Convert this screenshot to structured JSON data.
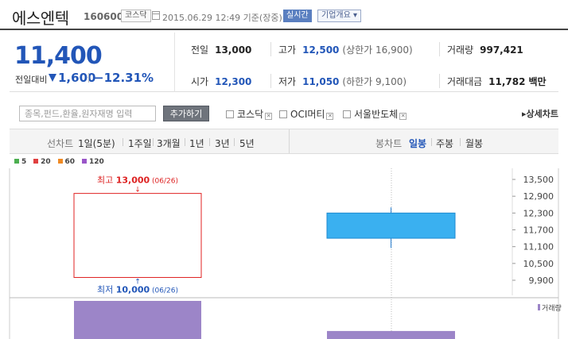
{
  "header": {
    "company_name": "에스엔텍",
    "stock_code": "160600",
    "market_badge": "코스닥",
    "datetime_text": "2015.06.29 12:49 기준(장중)",
    "realtime_badge": "실시간",
    "company_info_button": "기업개요 ▾"
  },
  "price": {
    "current": "11,400",
    "change_label": "전일대비",
    "change_value": "1,600",
    "change_percent": "−12.31%",
    "direction": "down"
  },
  "stats": {
    "prev_close_label": "전일",
    "prev_close": "13,000",
    "open_label": "시가",
    "open": "12,300",
    "high_label": "고가",
    "high": "12,500",
    "upper_limit": "(상한가 16,900)",
    "low_label": "저가",
    "low": "11,050",
    "lower_limit": "(하한가 9,100)",
    "volume_label": "거래량",
    "volume": "997,421",
    "amount_label": "거래대금",
    "amount": "11,782",
    "amount_unit": "백만"
  },
  "compare": {
    "search_placeholder": "종목,펀드,환율,원자재명 입력",
    "add_button": "추가하기",
    "options": [
      {
        "label": "코스닥"
      },
      {
        "label": "OCI머티"
      },
      {
        "label": "서울반도체"
      }
    ],
    "detail_chart_link": "▸상세차트"
  },
  "toolbar": {
    "line_chart_label": "선차트",
    "line_periods": [
      "1일(5분)",
      "1주일",
      "3개월",
      "1년",
      "3년",
      "5년"
    ],
    "candle_chart_label": "봉차트",
    "candle_periods": [
      "일봉",
      "주봉",
      "월봉"
    ],
    "active_candle": "일봉"
  },
  "legend": [
    {
      "label": "5",
      "color": "#4caf50"
    },
    {
      "label": "20",
      "color": "#e04040"
    },
    {
      "label": "60",
      "color": "#f08a24"
    },
    {
      "label": "120",
      "color": "#9a55c8"
    }
  ],
  "chart_data": {
    "type": "candlestick",
    "y_ticks": [
      "13,500",
      "12,900",
      "12,300",
      "11,700",
      "11,100",
      "10,500",
      "9,900"
    ],
    "high_annotation": {
      "label": "최고",
      "value": "13,000",
      "date": "(06/26)"
    },
    "low_annotation": {
      "label": "최저",
      "value": "10,000",
      "date": "(06/26)"
    },
    "candles": [
      {
        "date": "06/26",
        "open": 13000,
        "close": 10000,
        "high": 13000,
        "low": 10000,
        "style": "hollow-red"
      },
      {
        "date": "06/29",
        "open": 12300,
        "close": 11400,
        "high": 12500,
        "low": 11050,
        "style": "blue"
      }
    ],
    "volume_label": "거래량",
    "volume_bars": [
      {
        "date": "06/26",
        "relative": 1.0
      },
      {
        "date": "06/29",
        "relative": 0.21
      }
    ],
    "colors": {
      "up": "#e02020",
      "down": "#3ab0f0",
      "volume": "#9c85c8"
    }
  }
}
